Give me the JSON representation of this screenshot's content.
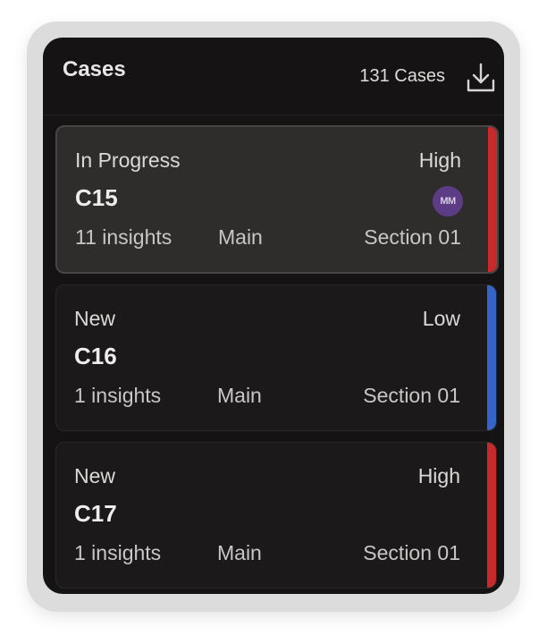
{
  "header": {
    "title": "Cases",
    "count_label": "131 Cases",
    "download_icon": "download-icon"
  },
  "cases": [
    {
      "status": "In Progress",
      "priority": "High",
      "id": "C15",
      "assignee_initials": "MM",
      "insights": "11 insights",
      "location": "Main",
      "section": "Section 01",
      "priority_color": "#c62a2a",
      "selected": true
    },
    {
      "status": "New",
      "priority": "Low",
      "id": "C16",
      "insights": "1 insights",
      "location": "Main",
      "section": "Section 01",
      "priority_color": "#3464c8",
      "selected": false
    },
    {
      "status": "New",
      "priority": "High",
      "id": "C17",
      "insights": "1 insights",
      "location": "Main",
      "section": "Section 01",
      "priority_color": "#c62a2a",
      "selected": false
    }
  ],
  "colors": {
    "panel_background": "#151313",
    "selected_card_background": "#2f2c2c",
    "high_priority": "#c62a2a",
    "low_priority": "#3464c8",
    "avatar_background": "#5d3c86"
  }
}
